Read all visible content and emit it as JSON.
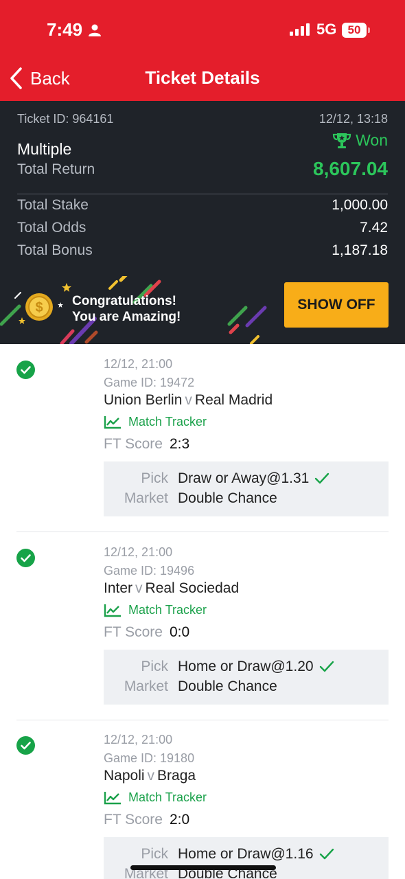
{
  "status_bar": {
    "time": "7:49",
    "network": "5G",
    "battery": "50"
  },
  "nav": {
    "back_label": "Back",
    "title": "Ticket Details"
  },
  "ticket": {
    "id_text": "Ticket ID: 964161",
    "date": "12/12, 13:18",
    "bet_type": "Multiple",
    "status": "Won",
    "total_return_label": "Total Return",
    "total_return": "8,607.04",
    "stats": [
      {
        "label": "Total Stake",
        "value": "1,000.00"
      },
      {
        "label": "Total Odds",
        "value": "7.42"
      },
      {
        "label": "Total Bonus",
        "value": "1,187.18"
      }
    ]
  },
  "banner": {
    "line1": "Congratulations!",
    "line2": "You are Amazing!",
    "button_label": "SHOW OFF"
  },
  "selections": [
    {
      "time": "12/12, 21:00",
      "game_id": "Game ID: 19472",
      "home": "Union Berlin",
      "vs": "v",
      "away": "Real Madrid",
      "tracker": "Match Tracker",
      "score_label": "FT Score",
      "score": "2:3",
      "pick_label": "Pick",
      "pick": "Draw or Away@1.31",
      "market_label": "Market",
      "market": "Double Chance"
    },
    {
      "time": "12/12, 21:00",
      "game_id": "Game ID: 19496",
      "home": "Inter",
      "vs": "v",
      "away": "Real Sociedad",
      "tracker": "Match Tracker",
      "score_label": "FT Score",
      "score": "0:0",
      "pick_label": "Pick",
      "pick": "Home or Draw@1.20",
      "market_label": "Market",
      "market": "Double Chance"
    },
    {
      "time": "12/12, 21:00",
      "game_id": "Game ID: 19180",
      "home": "Napoli",
      "vs": "v",
      "away": "Braga",
      "tracker": "Match Tracker",
      "score_label": "FT Score",
      "score": "2:0",
      "pick_label": "Pick",
      "pick": "Home or Draw@1.16",
      "market_label": "Market",
      "market": "Double Chance"
    }
  ],
  "colors": {
    "brand_red": "#e41e2b",
    "win_green": "#2cc65b",
    "accent_yellow": "#f8ad18",
    "dark_panel": "#1f2329"
  },
  "icons": [
    "person-icon",
    "signal-icon",
    "chevron-left-icon",
    "trophy-icon",
    "coin-icon",
    "check-circle-icon",
    "chart-icon",
    "checkmark-icon"
  ]
}
